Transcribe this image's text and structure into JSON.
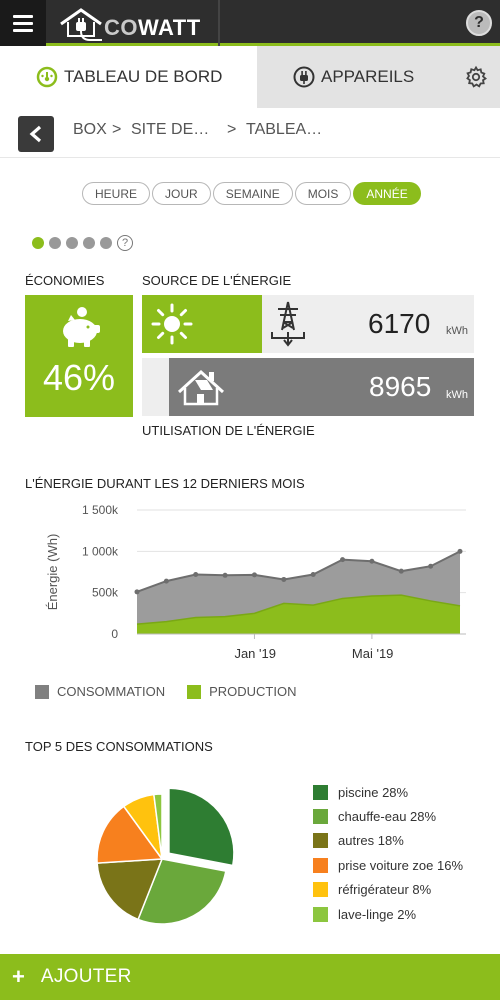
{
  "app": {
    "logo_part1": "CO",
    "logo_part2": "WATT",
    "help_glyph": "?"
  },
  "tabs": {
    "dashboard": "TABLEAU DE BORD",
    "devices": "APPAREILS"
  },
  "breadcrumb": {
    "items": [
      "BOX",
      "SITE DE…",
      "TABLEA…"
    ],
    "separator": ">"
  },
  "periods": {
    "items": [
      "HEURE",
      "JOUR",
      "SEMAINE",
      "MOIS",
      "ANNÉE"
    ],
    "selected": "ANNÉE"
  },
  "pager": {
    "count": 5,
    "active_index": 0,
    "help_glyph": "?"
  },
  "savings": {
    "label": "ÉCONOMIES",
    "value": "46%"
  },
  "energy": {
    "source_label": "SOURCE DE L'ÉNERGIE",
    "usage_label": "UTILISATION DE L'ÉNERGIE",
    "production_value": "6170",
    "production_unit": "kWh",
    "consumption_value": "8965",
    "consumption_unit": "kWh"
  },
  "chart_section": {
    "title": "L'ÉNERGIE DURANT LES 12 DERNIERS MOIS"
  },
  "chart_data": [
    {
      "type": "area",
      "ylabel": "Énergie (Wh)",
      "yticks": [
        "0",
        "500k",
        "1 000k",
        "1 500k"
      ],
      "ylim": [
        0,
        1500000
      ],
      "xticks": [
        "Jan '19",
        "Mai '19"
      ],
      "x": [
        "Sep '18",
        "Oct '18",
        "Nov '18",
        "Déc '18",
        "Jan '19",
        "Fév '19",
        "Mar '19",
        "Avr '19",
        "Mai '19",
        "Juin '19",
        "Juil '19",
        "Août '19"
      ],
      "series": [
        {
          "name": "CONSOMMATION",
          "color": "#808080",
          "values": [
            510000,
            640000,
            720000,
            710000,
            715000,
            660000,
            720000,
            900000,
            880000,
            760000,
            820000,
            1000000
          ]
        },
        {
          "name": "PRODUCTION",
          "color": "#8cbd1c",
          "values": [
            120000,
            150000,
            200000,
            210000,
            250000,
            370000,
            350000,
            430000,
            460000,
            470000,
            400000,
            340000
          ]
        }
      ],
      "grid": true,
      "legend": "bottom-left"
    },
    {
      "type": "pie",
      "title": "TOP 5 DES CONSOMMATIONS",
      "slices": [
        {
          "label": "piscine 28%",
          "value": 28,
          "color": "#2e7d32"
        },
        {
          "label": "chauffe-eau 28%",
          "value": 28,
          "color": "#6aa83b"
        },
        {
          "label": "autres 18%",
          "value": 18,
          "color": "#7a7418"
        },
        {
          "label": "prise voiture zoe 16%",
          "value": 16,
          "color": "#f7801e"
        },
        {
          "label": "réfrigérateur 8%",
          "value": 8,
          "color": "#ffc20e"
        },
        {
          "label": "lave-linge 2%",
          "value": 2,
          "color": "#8cc63f"
        }
      ],
      "legend": "right"
    }
  ],
  "add_bar": {
    "plus": "+",
    "label": "AJOUTER"
  }
}
